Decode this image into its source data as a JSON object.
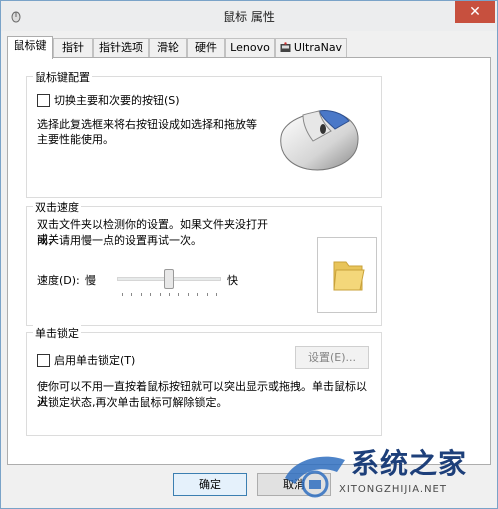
{
  "window": {
    "title": "鼠标 属性",
    "close_glyph": "✕"
  },
  "tabs": [
    {
      "label": "鼠标键"
    },
    {
      "label": "指针"
    },
    {
      "label": "指针选项"
    },
    {
      "label": "滑轮"
    },
    {
      "label": "硬件"
    },
    {
      "label": "Lenovo"
    },
    {
      "label": "UltraNav"
    }
  ],
  "button_config": {
    "group_label": "鼠标键配置",
    "switch_label": "切换主要和次要的按钮(S)",
    "description": "选择此复选框来将右按钮设成如选择和拖放等主要性能使用。"
  },
  "double_click": {
    "group_label": "双击速度",
    "description_line1": "双击文件夹以检测你的设置。如果文件夹没打开或关",
    "description_line2": "闭，请用慢一点的设置再试一次。",
    "speed_label": "速度(D):",
    "slow_label": "慢",
    "fast_label": "快",
    "speed_level": 0.5
  },
  "click_lock": {
    "group_label": "单击锁定",
    "enable_label": "启用单击锁定(T)",
    "settings_label": "设置(E)...",
    "description_line1": "使你可以不用一直按着鼠标按钮就可以突出显示或拖拽。单击鼠标以进",
    "description_line2": "入锁定状态,再次单击鼠标可解除锁定。"
  },
  "footer": {
    "ok_label": "确定",
    "cancel_label": "取消"
  },
  "watermark": {
    "brand": "系统之家",
    "subtext": "XITONGZHIJIA.NET"
  }
}
